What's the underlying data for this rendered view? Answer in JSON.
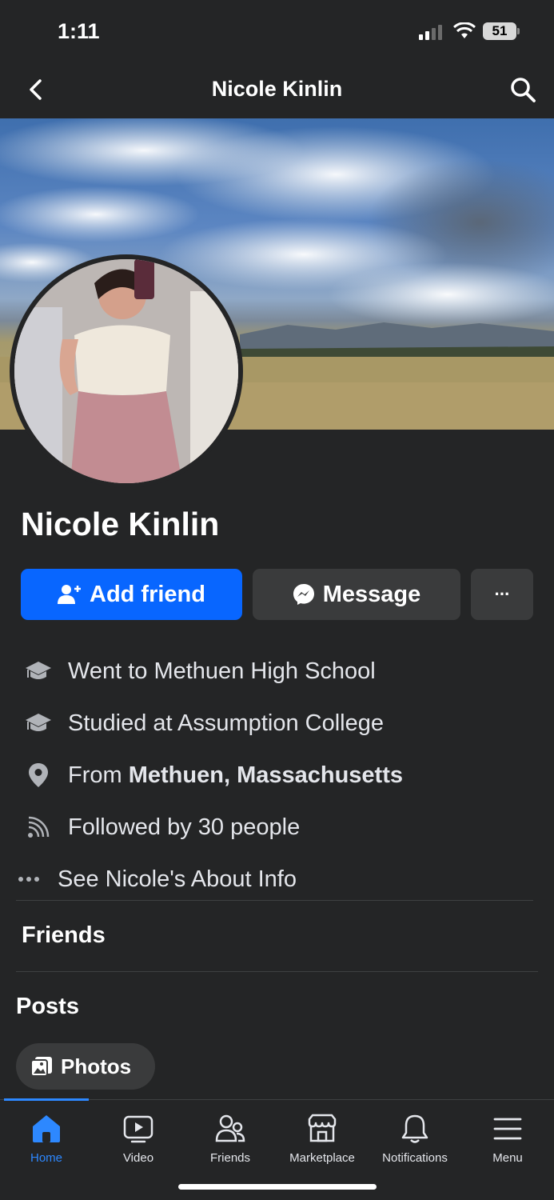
{
  "status_bar": {
    "time": "1:11",
    "battery": "51"
  },
  "header": {
    "title": "Nicole Kinlin",
    "back_icon": "chevron-left-icon",
    "search_icon": "search-icon"
  },
  "profile": {
    "name": "Nicole Kinlin",
    "add_friend_label": "Add friend",
    "message_label": "Message",
    "more_label": "···"
  },
  "info": {
    "school": "Went to Methuen High School",
    "college": "Studied at Assumption College",
    "from_prefix": "From",
    "from_place": "Methuen, Massachusetts",
    "followers": "Followed by 30 people",
    "about_link": "See Nicole's About Info"
  },
  "sections": {
    "friends": "Friends",
    "posts": "Posts",
    "photos_chip": "Photos"
  },
  "tabs": [
    {
      "label": "Home",
      "icon": "home-icon",
      "active": true
    },
    {
      "label": "Video",
      "icon": "video-icon",
      "active": false
    },
    {
      "label": "Friends",
      "icon": "friends-icon",
      "active": false
    },
    {
      "label": "Marketplace",
      "icon": "marketplace-icon",
      "active": false
    },
    {
      "label": "Notifications",
      "icon": "bell-icon",
      "active": false
    },
    {
      "label": "Menu",
      "icon": "menu-icon",
      "active": false
    }
  ],
  "colors": {
    "background": "#242526",
    "accent_blue": "#0866ff",
    "tab_active": "#2d88ff",
    "button_gray": "#3a3b3c"
  }
}
